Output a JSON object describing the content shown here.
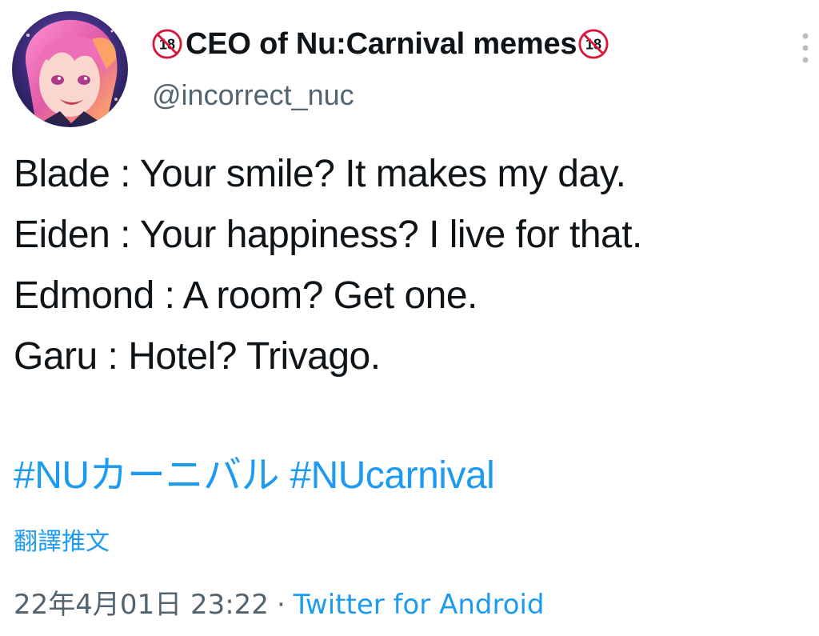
{
  "author": {
    "badge_text": "18",
    "display_name": "CEO of Nu:Carnival memes",
    "handle": "@incorrect_nuc"
  },
  "tweet": {
    "lines": [
      "Blade : Your smile? It makes my day.",
      "Eiden : Your happiness? I live for that.",
      "Edmond : A room? Get one.",
      "Garu : Hotel? Trivago."
    ],
    "hashtags": [
      "#NUカーニバル",
      "#NUcarnival"
    ]
  },
  "translate_label": "翻譯推文",
  "meta": {
    "timestamp": "22年4月01日 23:22",
    "separator": "·",
    "source": "Twitter for Android"
  },
  "icons": {
    "avatar": "avatar-image",
    "age_badge": "age-18-restricted-icon",
    "more": "more-vertical-icon"
  },
  "colors": {
    "link": "#1d9bf0",
    "secondary_text": "#536471",
    "primary_text": "#0f1419",
    "badge_red": "#d6173a"
  }
}
